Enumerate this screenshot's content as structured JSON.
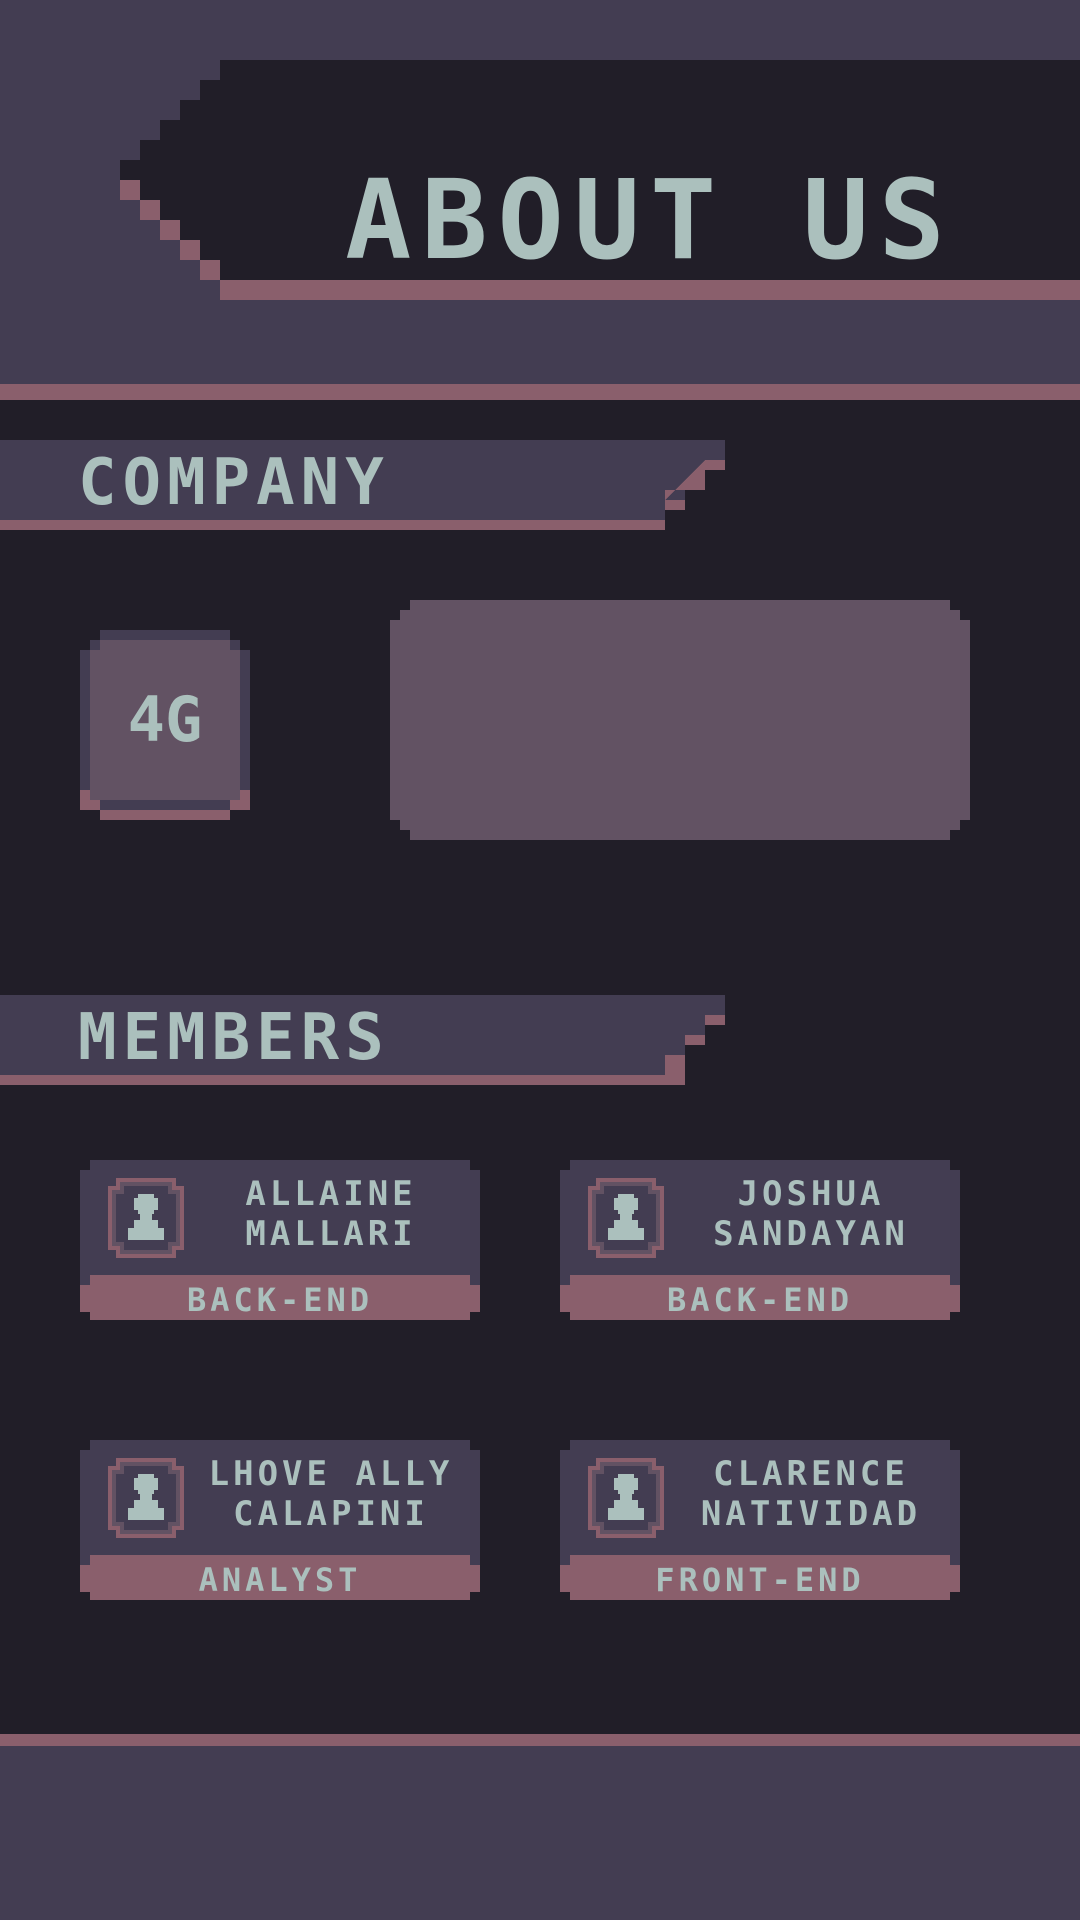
{
  "header": {
    "title": "ABOUT US"
  },
  "company": {
    "section_title": "COMPANY",
    "badge_text": "4G"
  },
  "members": {
    "section_title": "MEMBERS",
    "items": [
      {
        "first_name": "ALLAINE",
        "last_name": "MALLARI",
        "role": "BACK-END"
      },
      {
        "first_name": "JOSHUA",
        "last_name": "SANDAYAN",
        "role": "BACK-END"
      },
      {
        "first_name": "LHOVE ALLY",
        "last_name": "CALAPINI",
        "role": "ANALYST"
      },
      {
        "first_name": "CLARENCE",
        "last_name": "NATIVIDAD",
        "role": "FRONT-END"
      }
    ]
  },
  "colors": {
    "background": "#211e28",
    "panel": "#433d52",
    "accent": "#8a5f6c",
    "text": "#abc0bd",
    "badge": "#625263"
  },
  "icons": {
    "member_avatar": "person-icon"
  }
}
